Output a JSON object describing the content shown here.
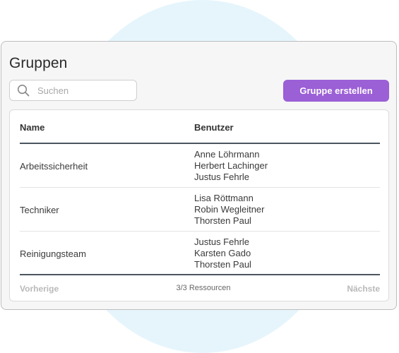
{
  "page": {
    "title": "Gruppen"
  },
  "search": {
    "placeholder": "Suchen",
    "value": ""
  },
  "toolbar": {
    "create_label": "Gruppe erstellen"
  },
  "table": {
    "columns": {
      "name": "Name",
      "users": "Benutzer"
    },
    "rows": [
      {
        "name": "Arbeitssicherheit",
        "users": [
          "Anne Löhrmann",
          "Herbert Lachinger",
          "Justus Fehrle"
        ]
      },
      {
        "name": "Techniker",
        "users": [
          "Lisa Röttmann",
          "Robin Wegleitner",
          "Thorsten Paul"
        ]
      },
      {
        "name": "Reinigungsteam",
        "users": [
          "Justus Fehrle",
          "Karsten Gado",
          "Thorsten Paul"
        ]
      }
    ]
  },
  "pagination": {
    "prev_label": "Vorherige",
    "count_label": "3/3 Ressourcen",
    "next_label": "Nächste"
  },
  "colors": {
    "accent": "#9b5fd6",
    "background_circle": "#e6f5fc",
    "header_rule": "#4b5560"
  },
  "icons": {
    "search": "search-icon"
  }
}
